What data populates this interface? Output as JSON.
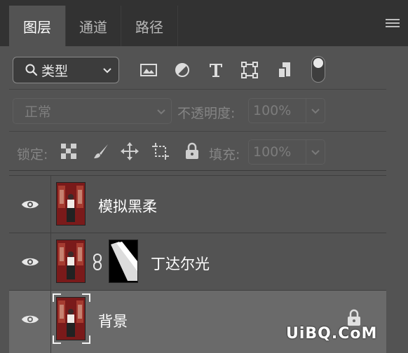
{
  "tabs": [
    {
      "label": "图层",
      "active": true
    },
    {
      "label": "通道",
      "active": false
    },
    {
      "label": "路径",
      "active": false
    }
  ],
  "filter": {
    "kind_label": "类型",
    "icons": [
      "image-filter-icon",
      "adjustment-filter-icon",
      "type-filter-icon",
      "shape-filter-icon",
      "smart-object-filter-icon"
    ]
  },
  "blend": {
    "mode": "正常",
    "opacity_label": "不透明度:",
    "opacity_value": "100%"
  },
  "lock": {
    "label": "锁定:",
    "fill_label": "填充:",
    "fill_value": "100%"
  },
  "layers": [
    {
      "name": "模拟黑柔",
      "visible": true,
      "selected": false,
      "has_mask": false,
      "locked": false
    },
    {
      "name": "丁达尔光",
      "visible": true,
      "selected": false,
      "has_mask": true,
      "locked": false
    },
    {
      "name": "背景",
      "visible": true,
      "selected": true,
      "has_mask": false,
      "locked": true
    }
  ],
  "watermark": "UiBQ.CoM",
  "colors": {
    "panel_bg": "#535353",
    "tabbar_bg": "#323232",
    "selected_row": "#6a6a6a",
    "photo_red": "#8b1e1e"
  }
}
